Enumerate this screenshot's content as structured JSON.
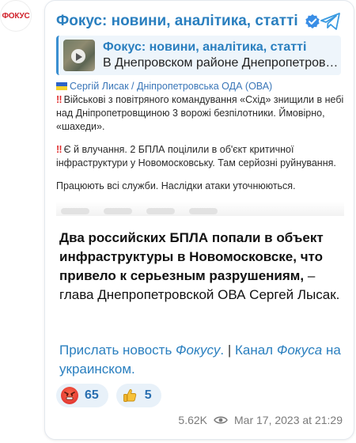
{
  "avatar": {
    "text": "ФОКУС"
  },
  "header": {
    "channel_title": "Фокус: новини, аналітика, статті"
  },
  "reply": {
    "title": "Фокус: новини, аналітика, статті",
    "preview": "В Днепровском районе Днепропетровской области"
  },
  "screenshot": {
    "author": "Сергій Лисак / Дніпропетровська ОДА (ОВА)",
    "p1_l1": "Військові з повітряного командування «Схід» знищили в небі",
    "p1_l2": "над Дніпропетровщиною 3 ворожі безпілотники. Ймовірно,",
    "p1_l3": "«шахеди».",
    "p2_l1": "Є й влучання. 2 БПЛА поцілили в об'єкт критичної",
    "p2_l2": "інфраструктури у Новомосковську. Там серйозні руйнування.",
    "p3_l1": "Працюють всі служби. Наслідки атаки уточнюються."
  },
  "post": {
    "bold": "Два российских БПЛА попали в объект инфраструктуры в Новомосковске, что привело к серьезным разрушениям,",
    "rest": " – глава Днепропетровской ОВА Сергей Лысак."
  },
  "links": {
    "l1_a": "Прислать новость ",
    "l1_b": "Фокусу",
    "l1_c": ".",
    "sep": " | ",
    "l2_a": "Канал ",
    "l2_b": "Фокуса",
    "l2_c": " на украинском."
  },
  "reactions": [
    {
      "icon": "angry-face-icon",
      "count": "65"
    },
    {
      "icon": "thumbs-up-icon",
      "count": "5"
    }
  ],
  "meta": {
    "views": "5.62K",
    "date": "Mar 17, 2023 at 21:29"
  },
  "colors": {
    "accent": "#2a7fbf",
    "brand": "#d0202a",
    "reaction_bg": "#e8f1f9"
  }
}
